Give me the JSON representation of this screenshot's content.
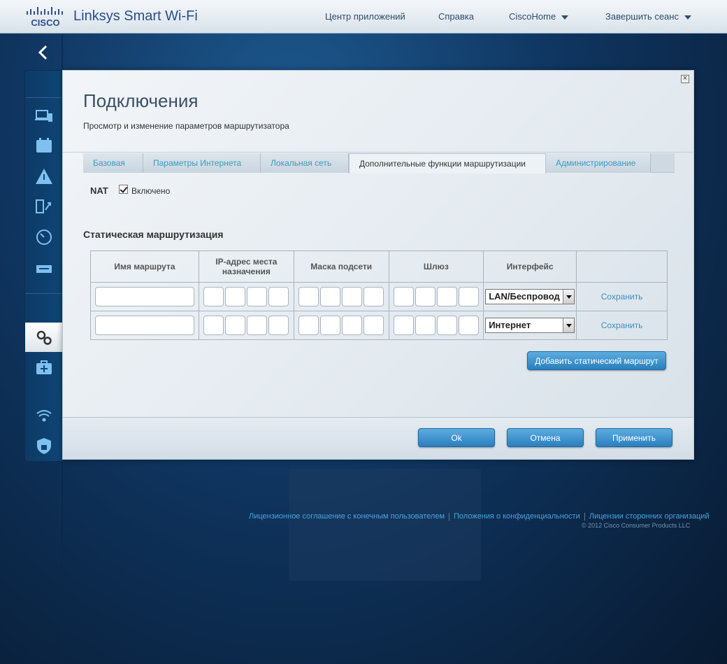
{
  "header": {
    "logo_text": "CISCO",
    "brand": "Linksys Smart Wi-Fi",
    "nav": [
      "Центр приложений",
      "Справка",
      "CiscoHome",
      "Завершить сеанс"
    ]
  },
  "modal": {
    "title": "Подключения",
    "subtitle": "Просмотр и изменение параметров маршрутизатора",
    "tabs": [
      "Базовая",
      "Параметры Интернета",
      "Локальная сеть",
      "Дополнительные функции маршрутизации",
      "Администрирование"
    ],
    "active_tab": "Дополнительные функции маршрутизации",
    "nat": {
      "label": "NAT",
      "checkbox_label": "Включено",
      "checked": true
    },
    "static_routing": {
      "title": "Статическая маршрутизация",
      "columns": [
        "Имя маршрута",
        "IP-адрес места назначения",
        "Маска подсети",
        "Шлюз",
        "Интерфейс",
        ""
      ],
      "rows": [
        {
          "interface": "LAN/Беспровод",
          "action": "Сохранить"
        },
        {
          "interface": "Интернет",
          "action": "Сохранить"
        }
      ],
      "add_button": "Добавить статический маршрут"
    },
    "buttons": {
      "ok": "Ok",
      "cancel": "Отмена",
      "apply": "Применить"
    }
  },
  "footer": {
    "links": [
      "Лицензионное соглашение с конечным пользователем",
      "Положения о конфиденциальности",
      "Лицензии сторонних организаций"
    ],
    "copyright": "© 2012 Cisco Consumer Products LLC"
  },
  "colors": {
    "accent": "#3b9bbf",
    "button": "#2a7fbe",
    "brand": "#28508a"
  }
}
